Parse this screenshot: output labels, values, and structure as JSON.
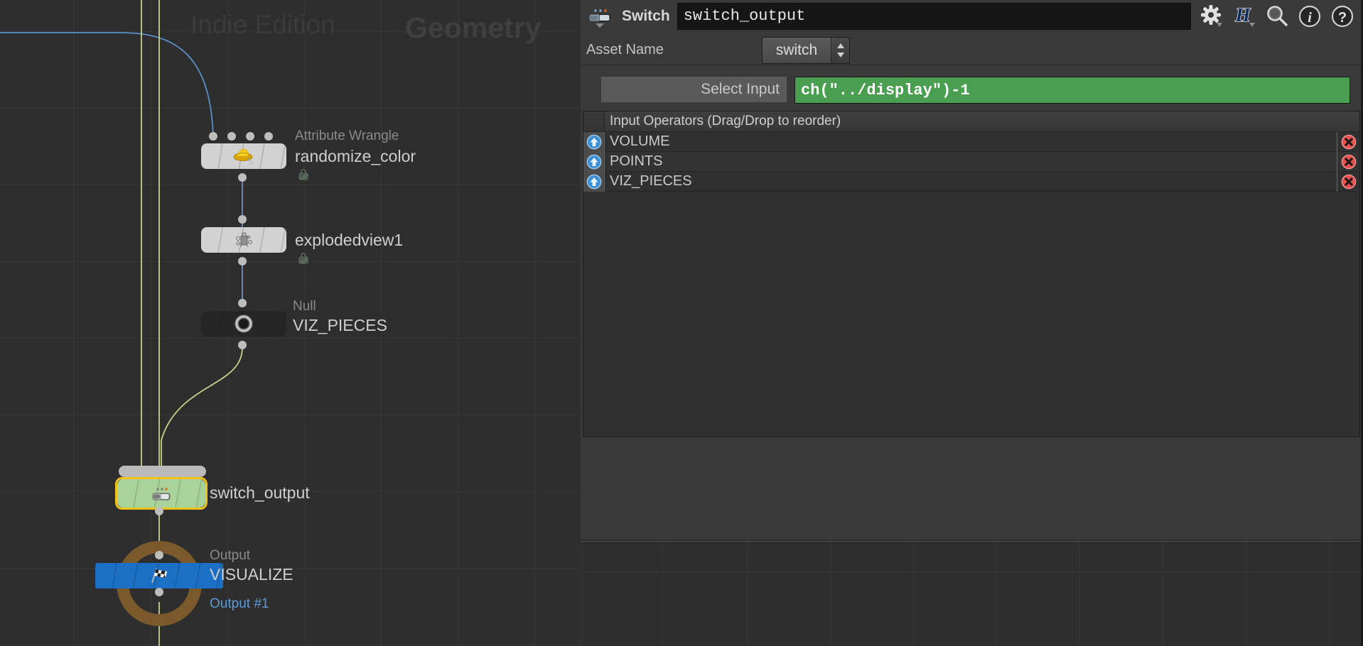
{
  "network": {
    "watermark_edition": "Indie Edition",
    "watermark_context": "Geometry",
    "nodes": [
      {
        "type_label": "Attribute Wrangle",
        "name": "randomize_color",
        "icon": "vex-wrangle-hat-icon",
        "color": "#d2d2d2",
        "inputs": 4,
        "outputs": 1,
        "has_lock_flag": true
      },
      {
        "type_label": "",
        "name": "explodedview1",
        "icon": "explodedview-icon",
        "color": "#d2d2d2",
        "inputs": 1,
        "outputs": 1,
        "has_lock_flag": true
      },
      {
        "type_label": "Null",
        "name": "VIZ_PIECES",
        "icon": "null-ring-icon",
        "color": "#262626",
        "inputs": 1,
        "outputs": 1,
        "has_lock_flag": false
      },
      {
        "type_label": "",
        "name": "switch_output",
        "icon": "switch-icon",
        "color": "#a9d39a",
        "selected": true,
        "inputs": 3,
        "outputs": 1,
        "has_lock_flag": false
      },
      {
        "type_label": "Output",
        "name": "VISUALIZE",
        "sublabel": "Output #1",
        "icon": "checkered-flag-icon",
        "color": "#1b6fc4",
        "display_flag": true,
        "inputs": 1,
        "outputs": 1,
        "has_lock_flag": false
      }
    ],
    "colors": {
      "background": "#2e2e2e",
      "wire_default": "#c8d18a",
      "wire_blue": "#5b8fc9",
      "selection": "#f2c21a",
      "display_ring": "#7a5a2c"
    }
  },
  "parameters": {
    "header": {
      "node_type_icon": "switch-node-icon",
      "node_type_label": "Switch",
      "node_name_value": "switch_output",
      "icons": [
        {
          "name": "gear-icon",
          "tooltip": "Gear menu"
        },
        {
          "name": "houdini-h-icon",
          "tooltip": "Houdini menu"
        },
        {
          "name": "search-icon",
          "tooltip": "Search parameters"
        },
        {
          "name": "info-icon",
          "tooltip": "Node info"
        },
        {
          "name": "help-icon",
          "tooltip": "Help"
        }
      ]
    },
    "asset_name": {
      "label": "Asset Name",
      "value": "switch",
      "spinner": "updown-spinner-icon"
    },
    "select_input": {
      "button_label": "Select Input",
      "expression_value": "ch(\"../display\")-1",
      "expression_color": "#4a9e4f"
    },
    "input_operators": {
      "header": "Input Operators (Drag/Drop to reorder)",
      "rows": [
        {
          "name": "VOLUME",
          "move_icon": "up-arrow-icon",
          "delete_icon": "delete-x-icon"
        },
        {
          "name": "POINTS",
          "move_icon": "up-arrow-icon",
          "delete_icon": "delete-x-icon"
        },
        {
          "name": "VIZ_PIECES",
          "move_icon": "up-arrow-icon",
          "delete_icon": "delete-x-icon"
        }
      ]
    }
  }
}
